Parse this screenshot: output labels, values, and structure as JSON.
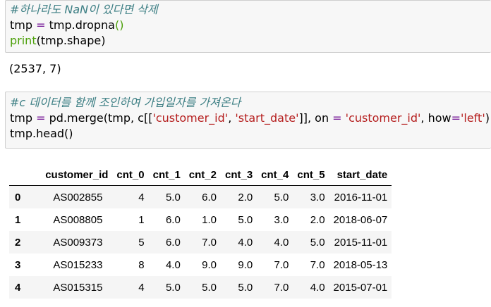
{
  "cell1": {
    "comment": "#하나라도 NaN이 있다면 삭제",
    "line2": {
      "lhs": "tmp ",
      "op": "=",
      "rhs": " tmp.dropna",
      "paren": "()"
    },
    "line3": {
      "fn": "print",
      "rest": "(tmp.shape)"
    }
  },
  "output1": "(2537, 7)",
  "cell2": {
    "comment": "#c 데이터를 함께 조인하여 가입일자를 가져온다",
    "line2": {
      "part1": "tmp ",
      "eq1": "=",
      "part2": " pd.merge(tmp, c[[",
      "s1": "'customer_id'",
      "part3": ", ",
      "s2": "'start_date'",
      "part4": "]], on ",
      "eq2": "=",
      "part5": " ",
      "s3": "'customer_id'",
      "part6": ", how",
      "eq3": "=",
      "s4": "'left'",
      "part7": ")"
    },
    "line3": "tmp.head()"
  },
  "table": {
    "columns": [
      "",
      "customer_id",
      "cnt_0",
      "cnt_1",
      "cnt_2",
      "cnt_3",
      "cnt_4",
      "cnt_5",
      "start_date"
    ],
    "rows": [
      [
        "0",
        "AS002855",
        "4",
        "5.0",
        "6.0",
        "2.0",
        "5.0",
        "3.0",
        "2016-11-01"
      ],
      [
        "1",
        "AS008805",
        "1",
        "6.0",
        "1.0",
        "5.0",
        "3.0",
        "2.0",
        "2018-06-07"
      ],
      [
        "2",
        "AS009373",
        "5",
        "6.0",
        "7.0",
        "4.0",
        "4.0",
        "5.0",
        "2015-11-01"
      ],
      [
        "3",
        "AS015233",
        "8",
        "4.0",
        "9.0",
        "9.0",
        "7.0",
        "7.0",
        "2018-05-13"
      ],
      [
        "4",
        "AS015315",
        "4",
        "5.0",
        "5.0",
        "5.0",
        "7.0",
        "4.0",
        "2015-07-01"
      ]
    ]
  }
}
